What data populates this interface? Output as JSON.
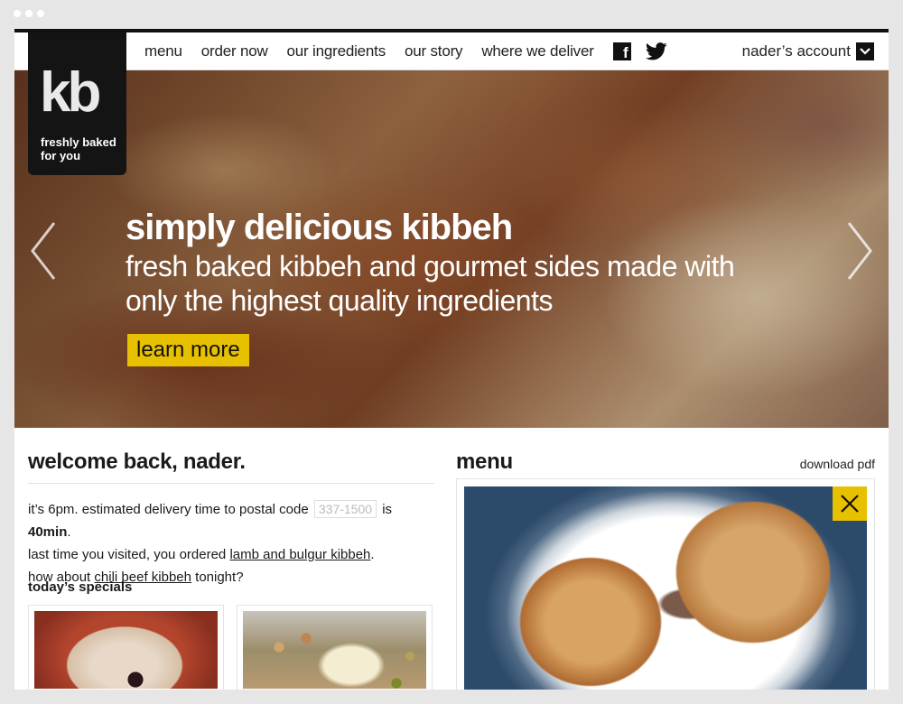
{
  "nav": {
    "items": [
      "menu",
      "order now",
      "our ingredients",
      "our story",
      "where we deliver"
    ],
    "social": [
      "facebook-icon",
      "twitter-icon"
    ],
    "account_label": "nader’s account"
  },
  "logo": {
    "mark": "kb",
    "tagline": "freshly baked for you"
  },
  "hero": {
    "title": "simply delicious kibbeh",
    "subtitle": "fresh baked kibbeh and gourmet sides made with only the highest quality ingredients",
    "cta": "learn more"
  },
  "welcome": {
    "heading": "welcome back, nader.",
    "line1_a": "it’s 6pm. estimated delivery time to postal code",
    "postal_code_placeholder": "337-1500",
    "line1_b": "is",
    "eta": "40min",
    "line1_c": ".",
    "line2_a": "last time you visited, you ordered",
    "last_order": "lamb and bulgur kibbeh",
    "line2_b": ".",
    "line3_a": "how about",
    "suggestion": "chili beef kibbeh",
    "line3_b": "tonight?"
  },
  "specials": {
    "heading": "today’s specials"
  },
  "menu": {
    "heading": "menu",
    "download": "download pdf"
  },
  "colors": {
    "accent": "#e7c000",
    "dark": "#141414"
  }
}
